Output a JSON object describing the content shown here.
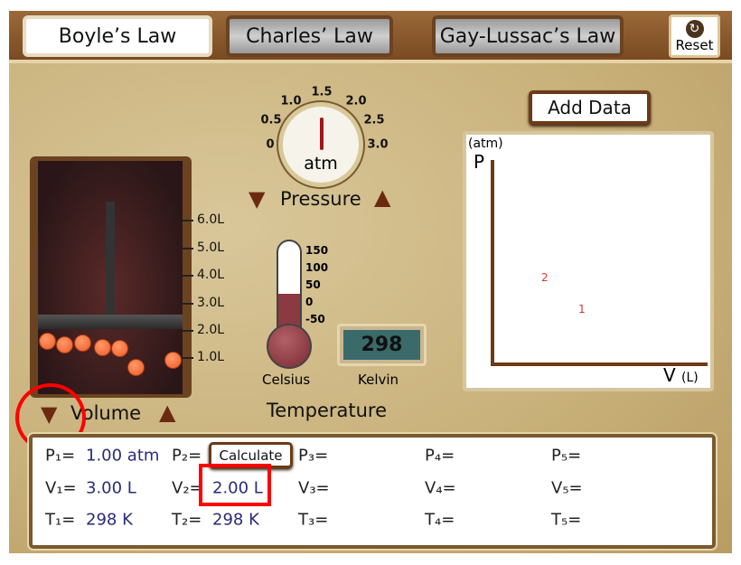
{
  "tabs": [
    {
      "label": "Boyle’s Law",
      "active": true
    },
    {
      "label": "Charles’ Law",
      "active": false
    },
    {
      "label": "Gay-Lussac’s Law",
      "active": false
    }
  ],
  "reset_label": "Reset",
  "gauge": {
    "labels": [
      "0",
      "0.5",
      "1.0",
      "1.5",
      "2.0",
      "2.5",
      "3.0"
    ],
    "unit": "atm",
    "value_atm": 1.5
  },
  "pressure_label": "Pressure",
  "cylinder": {
    "ticks": [
      "6.0L",
      "5.0L",
      "4.0L",
      "3.0L",
      "2.0L",
      "1.0L"
    ],
    "volume_L": 2.0
  },
  "volume_label": "Volume",
  "thermometer": {
    "ticks": [
      "150",
      "100",
      "50",
      "0",
      "-50"
    ],
    "label": "Celsius"
  },
  "kelvin": {
    "value": "298",
    "label": "Kelvin"
  },
  "temperature_label": "Temperature",
  "add_data_label": "Add Data",
  "graph": {
    "y_unit": "(atm)",
    "y_label": "P",
    "x_label": "V",
    "x_unit": "(L)",
    "point_labels": [
      "2",
      "1"
    ],
    "point_color": "#e03030"
  },
  "table": {
    "calculate_label": "Calculate",
    "rows": [
      {
        "labels": [
          "P₁=",
          "P₂=",
          "P₃=",
          "P₄=",
          "P₅="
        ],
        "v1": "1.00 atm"
      },
      {
        "labels": [
          "V₁=",
          "V₂=",
          "V₃=",
          "V₄=",
          "V₅="
        ],
        "v1": "3.00 L",
        "v2": "2.00 L"
      },
      {
        "labels": [
          "T₁=",
          "T₂=",
          "T₃=",
          "T₄=",
          "T₅="
        ],
        "v1": "298 K",
        "v2": "298 K"
      }
    ]
  },
  "highlight_color": "#ff0000"
}
